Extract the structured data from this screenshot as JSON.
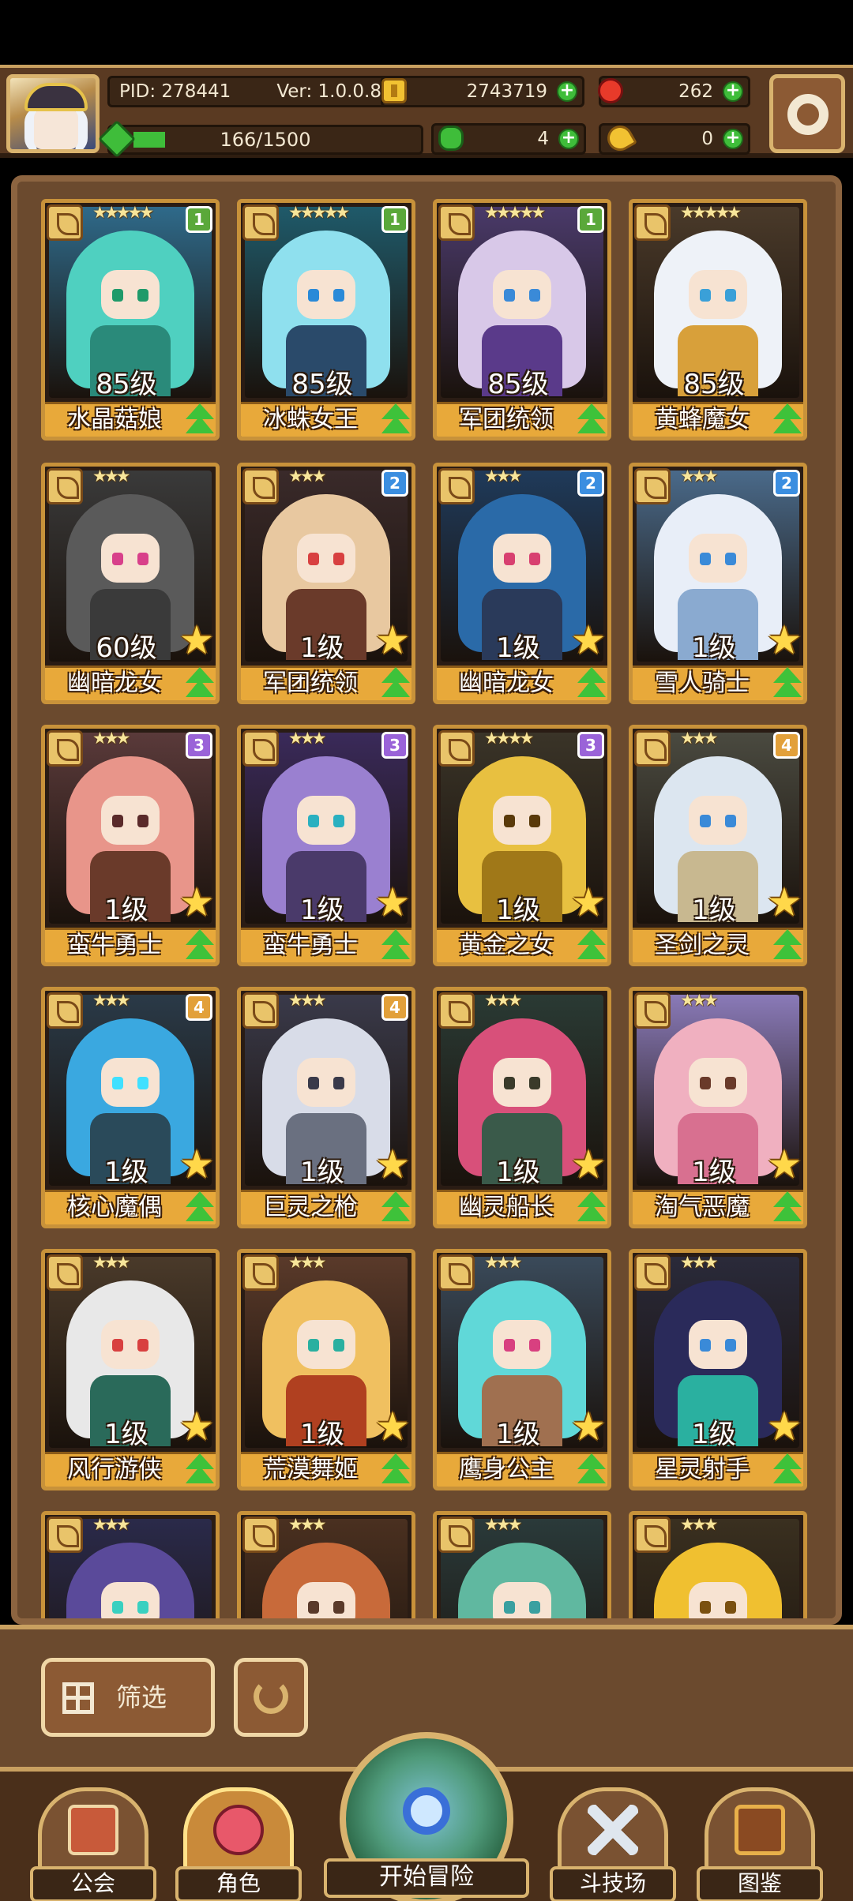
{
  "header": {
    "pid": "PID: 278441",
    "version": "Ver: 1.0.0.8",
    "gold": "2743719",
    "gems": "262",
    "energy": "166/1500",
    "clover": "4",
    "keys": "0",
    "energy_fraction": 0.11
  },
  "cards": [
    {
      "name": "水晶菇娘",
      "level": "85级",
      "stars": "★★★★★",
      "badge": "1",
      "badge_color": "b1",
      "hair": "#4fd0c0",
      "body": "#2a8a7a",
      "eye": "#1f9a6a",
      "bg": "#2f6a8a",
      "show_star": false
    },
    {
      "name": "冰蛛女王",
      "level": "85级",
      "stars": "★★★★★",
      "badge": "1",
      "badge_color": "b1",
      "hair": "#8fe0ee",
      "body": "#2a4a6a",
      "eye": "#2a8ad8",
      "bg": "#1f5a6a",
      "show_star": false
    },
    {
      "name": "军团统领",
      "level": "85级",
      "stars": "★★★★★",
      "badge": "1",
      "badge_color": "b1",
      "hair": "#d8c8e8",
      "body": "#5a3a8a",
      "eye": "#3a8ad8",
      "bg": "#4a3a6a",
      "show_star": false
    },
    {
      "name": "黄蜂魔女",
      "level": "85级",
      "stars": "★★★★★",
      "badge": "",
      "badge_color": "",
      "hair": "#eef2f8",
      "body": "#d8a03a",
      "eye": "#3aa0d8",
      "bg": "#4a3a2a",
      "show_star": false
    },
    {
      "name": "幽暗龙女",
      "level": "60级",
      "stars": "★★★",
      "badge": "",
      "badge_color": "",
      "hair": "#5a5a5a",
      "body": "#3a3a3a",
      "eye": "#d8408a",
      "bg": "#3a3a3a",
      "show_star": true
    },
    {
      "name": "军团统领",
      "level": "1级",
      "stars": "★★★",
      "badge": "2",
      "badge_color": "b2",
      "hair": "#e8c8a0",
      "body": "#6a3a2a",
      "eye": "#d84040",
      "bg": "#3a2a2a",
      "show_star": true
    },
    {
      "name": "幽暗龙女",
      "level": "1级",
      "stars": "★★★",
      "badge": "2",
      "badge_color": "b2",
      "hair": "#2a6aa8",
      "body": "#2a3a5a",
      "eye": "#d84070",
      "bg": "#1f3a5a",
      "show_star": true
    },
    {
      "name": "雪人骑士",
      "level": "1级",
      "stars": "★★★",
      "badge": "2",
      "badge_color": "b2",
      "hair": "#e8eef8",
      "body": "#8aaad0",
      "eye": "#3a8ad8",
      "bg": "#4a6a8a",
      "show_star": true
    },
    {
      "name": "蛮牛勇士",
      "level": "1级",
      "stars": "★★★",
      "badge": "3",
      "badge_color": "b3",
      "hair": "#e8958a",
      "body": "#6a3a2a",
      "eye": "#5a2a2a",
      "bg": "#5a3a3a",
      "show_star": true
    },
    {
      "name": "蛮牛勇士",
      "level": "1级",
      "stars": "★★★",
      "badge": "3",
      "badge_color": "b3",
      "hair": "#9a80d0",
      "body": "#4a3a6a",
      "eye": "#2ab0c0",
      "bg": "#3a2a5a",
      "show_star": true
    },
    {
      "name": "黄金之女",
      "level": "1级",
      "stars": "★★★★",
      "badge": "3",
      "badge_color": "b3",
      "hair": "#e8c040",
      "body": "#a07818",
      "eye": "#5a3a0a",
      "bg": "#3a3428",
      "show_star": true
    },
    {
      "name": "圣剑之灵",
      "level": "1级",
      "stars": "★★★",
      "badge": "4",
      "badge_color": "b4",
      "hair": "#dce6f0",
      "body": "#c8b890",
      "eye": "#3a8ad8",
      "bg": "#4a4a40",
      "show_star": true
    },
    {
      "name": "核心魔偶",
      "level": "1级",
      "stars": "★★★",
      "badge": "4",
      "badge_color": "b4",
      "hair": "#3aa8e0",
      "body": "#2a4a5a",
      "eye": "#40e0ff",
      "bg": "#2a3a48",
      "show_star": true
    },
    {
      "name": "巨灵之枪",
      "level": "1级",
      "stars": "★★★",
      "badge": "4",
      "badge_color": "b4",
      "hair": "#d8dce8",
      "body": "#6a7080",
      "eye": "#3a3a4a",
      "bg": "#3a3a4a",
      "show_star": true
    },
    {
      "name": "幽灵船长",
      "level": "1级",
      "stars": "★★★",
      "badge": "",
      "badge_color": "",
      "hair": "#d8507a",
      "body": "#3a5a4a",
      "eye": "#3a3a2a",
      "bg": "#2a3a34",
      "show_star": true
    },
    {
      "name": "淘气恶魔",
      "level": "1级",
      "stars": "★★★",
      "badge": "",
      "badge_color": "",
      "hair": "#f0b0c0",
      "body": "#d87090",
      "eye": "#6a3a2a",
      "bg": "#8a7ab8",
      "show_star": true
    },
    {
      "name": "风行游侠",
      "level": "1级",
      "stars": "★★★",
      "badge": "",
      "badge_color": "",
      "hair": "#e8e8e8",
      "body": "#2a6a5a",
      "eye": "#d84040",
      "bg": "#4a3a2a",
      "show_star": true
    },
    {
      "name": "荒漠舞姬",
      "level": "1级",
      "stars": "★★★",
      "badge": "",
      "badge_color": "",
      "hair": "#f0c060",
      "body": "#b04020",
      "eye": "#2ab0a0",
      "bg": "#5a3a2a",
      "show_star": true
    },
    {
      "name": "鹰身公主",
      "level": "1级",
      "stars": "★★★",
      "badge": "",
      "badge_color": "",
      "hair": "#60d8d8",
      "body": "#a07050",
      "eye": "#d84080",
      "bg": "#3a4a5a",
      "show_star": true
    },
    {
      "name": "星灵射手",
      "level": "1级",
      "stars": "★★★",
      "badge": "",
      "badge_color": "",
      "hair": "#2a2a5a",
      "body": "#2ab0a0",
      "eye": "#3a8ad8",
      "bg": "#2a2a3a",
      "show_star": true
    },
    {
      "name": "",
      "level": "",
      "stars": "★★★",
      "badge": "",
      "badge_color": "",
      "hair": "#5a4a9a",
      "body": "#3a2a5a",
      "eye": "#3ad0c0",
      "bg": "#2a2a4a",
      "show_star": false
    },
    {
      "name": "",
      "level": "",
      "stars": "★★★",
      "badge": "",
      "badge_color": "",
      "hair": "#c86a3a",
      "body": "#8a4a2a",
      "eye": "#5a3a2a",
      "bg": "#4a3020",
      "show_star": false
    },
    {
      "name": "",
      "level": "",
      "stars": "★★★",
      "badge": "",
      "badge_color": "",
      "hair": "#60b8a0",
      "body": "#2a4a4a",
      "eye": "#3aa0a0",
      "bg": "#2a3a3a",
      "show_star": false
    },
    {
      "name": "",
      "level": "",
      "stars": "★★★",
      "badge": "",
      "badge_color": "",
      "hair": "#f0c030",
      "body": "#c89020",
      "eye": "#7a5010",
      "bg": "#3a3020",
      "show_star": false
    }
  ],
  "toolbar": {
    "filter_label": "筛选"
  },
  "nav": {
    "guild": "公会",
    "character": "角色",
    "adventure": "开始冒险",
    "arena": "斗技场",
    "codex": "图鉴"
  }
}
